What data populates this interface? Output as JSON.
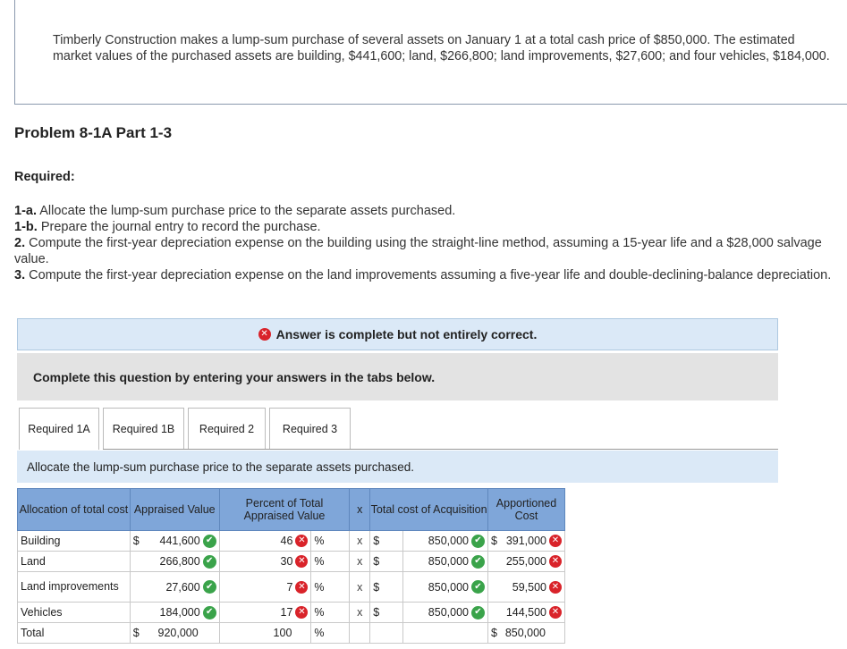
{
  "problem_text": "Timberly Construction makes a lump-sum purchase of several assets on January 1 at a total cash price of $850,000. The estimated market values of the purchased assets are building, $441,600; land, $266,800; land improvements, $27,600; and four vehicles, $184,000.",
  "part_title": "Problem 8-1A Part 1-3",
  "required_label": "Required:",
  "requirements": [
    {
      "num": "1-a.",
      "text": "Allocate the lump-sum purchase price to the separate assets purchased."
    },
    {
      "num": "1-b.",
      "text": "Prepare the journal entry to record the purchase."
    },
    {
      "num": "2.",
      "text": "Compute the first-year depreciation expense on the building using the straight-line method, assuming a 15-year life and a $28,000 salvage value."
    },
    {
      "num": "3.",
      "text": "Compute the first-year depreciation expense on the land improvements assuming a five-year life and double-declining-balance depreciation."
    }
  ],
  "status_banner": "Answer is complete but not entirely correct.",
  "instruction": "Complete this question by entering your answers in the tabs below.",
  "tabs": [
    "Required 1A",
    "Required 1B",
    "Required 2",
    "Required 3"
  ],
  "tab_description": "Allocate the lump-sum purchase price to the separate assets purchased.",
  "table": {
    "headers": {
      "allocation": "Allocation of total cost",
      "appraised": "Appraised Value",
      "percent": "Percent of Total Appraised Value",
      "times": "x",
      "total_cost": "Total cost of Acquisition",
      "apportioned": "Apportioned Cost"
    },
    "rows": [
      {
        "label": "Building",
        "dollar": "$",
        "appraised": "441,600",
        "percent": "46",
        "pct_sign": "%",
        "times": "x",
        "cost_dollar": "$",
        "total_cost": "850,000",
        "app_dollar": "$",
        "apportioned": "391,000"
      },
      {
        "label": "Land",
        "dollar": "",
        "appraised": "266,800",
        "percent": "30",
        "pct_sign": "%",
        "times": "x",
        "cost_dollar": "$",
        "total_cost": "850,000",
        "app_dollar": "",
        "apportioned": "255,000"
      },
      {
        "label": "Land improvements",
        "dollar": "",
        "appraised": "27,600",
        "percent": "7",
        "pct_sign": "%",
        "times": "x",
        "cost_dollar": "$",
        "total_cost": "850,000",
        "app_dollar": "",
        "apportioned": "59,500"
      },
      {
        "label": "Vehicles",
        "dollar": "",
        "appraised": "184,000",
        "percent": "17",
        "pct_sign": "%",
        "times": "x",
        "cost_dollar": "$",
        "total_cost": "850,000",
        "app_dollar": "",
        "apportioned": "144,500"
      }
    ],
    "total": {
      "label": "Total",
      "dollar": "$",
      "appraised": "920,000",
      "percent": "100",
      "pct_sign": "%",
      "app_dollar": "$",
      "apportioned": "850,000"
    }
  },
  "icons": {
    "correct": "check-circle-icon",
    "incorrect": "x-circle-icon"
  },
  "colors": {
    "header_bg": "#7fa6d9",
    "banner_bg": "#dbe9f7",
    "correct": "#3aa34a",
    "incorrect": "#d9232a"
  }
}
